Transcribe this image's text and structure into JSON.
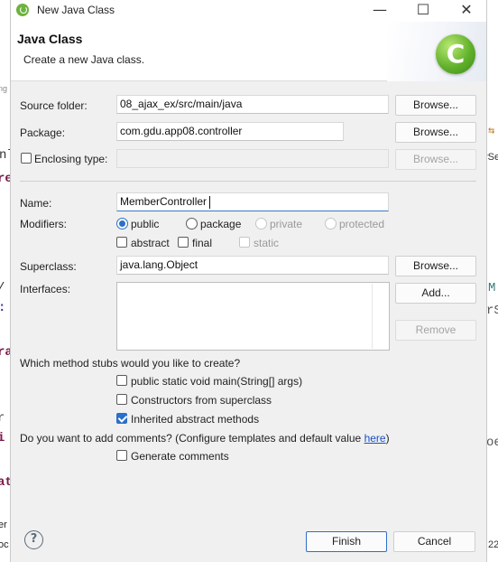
{
  "window": {
    "title": "New Java Class",
    "controls": {
      "minimize": "—",
      "maximize": "☐",
      "close": "✕"
    }
  },
  "banner": {
    "title": "Java Class",
    "subtitle": "Create a new Java class.",
    "icon": "java-class-wizard-icon",
    "icon_glyph": "C"
  },
  "form": {
    "source_folder": {
      "label": "Source folder:",
      "value": "08_ajax_ex/src/main/java",
      "browse": "Browse..."
    },
    "package": {
      "label": "Package:",
      "value": "com.gdu.app08.controller",
      "browse": "Browse..."
    },
    "enclosing_type": {
      "label": "Enclosing type:",
      "checked": false,
      "value": "",
      "browse": "Browse..."
    },
    "name": {
      "label": "Name:",
      "value": "MemberController"
    },
    "modifiers": {
      "label": "Modifiers:",
      "access": [
        {
          "label": "public",
          "selected": true,
          "enabled": true
        },
        {
          "label": "package",
          "selected": false,
          "enabled": true
        },
        {
          "label": "private",
          "selected": false,
          "enabled": false
        },
        {
          "label": "protected",
          "selected": false,
          "enabled": false
        }
      ],
      "flags": [
        {
          "label": "abstract",
          "checked": false,
          "enabled": true
        },
        {
          "label": "final",
          "checked": false,
          "enabled": true
        },
        {
          "label": "static",
          "checked": false,
          "enabled": false
        }
      ]
    },
    "superclass": {
      "label": "Superclass:",
      "value": "java.lang.Object",
      "browse": "Browse..."
    },
    "interfaces": {
      "label": "Interfaces:",
      "add": "Add...",
      "remove": "Remove",
      "items": []
    },
    "stubs": {
      "question": "Which method stubs would you like to create?",
      "options": [
        {
          "label": "public static void main(String[] args)",
          "checked": false
        },
        {
          "label": "Constructors from superclass",
          "checked": false
        },
        {
          "label": "Inherited abstract methods",
          "checked": true
        }
      ]
    },
    "comments": {
      "question": "Do you want to add comments? (Configure templates and default value ",
      "link": "here",
      "close": ")",
      "option": {
        "label": "Generate comments",
        "checked": false
      }
    }
  },
  "footer": {
    "help": "?",
    "finish": "Finish",
    "cancel": "Cancel"
  },
  "colors": {
    "accent": "#2a6fc9",
    "link": "#1a4fc4",
    "dialog_bg": "#f0f0f0",
    "logo": "#62b12c"
  }
}
